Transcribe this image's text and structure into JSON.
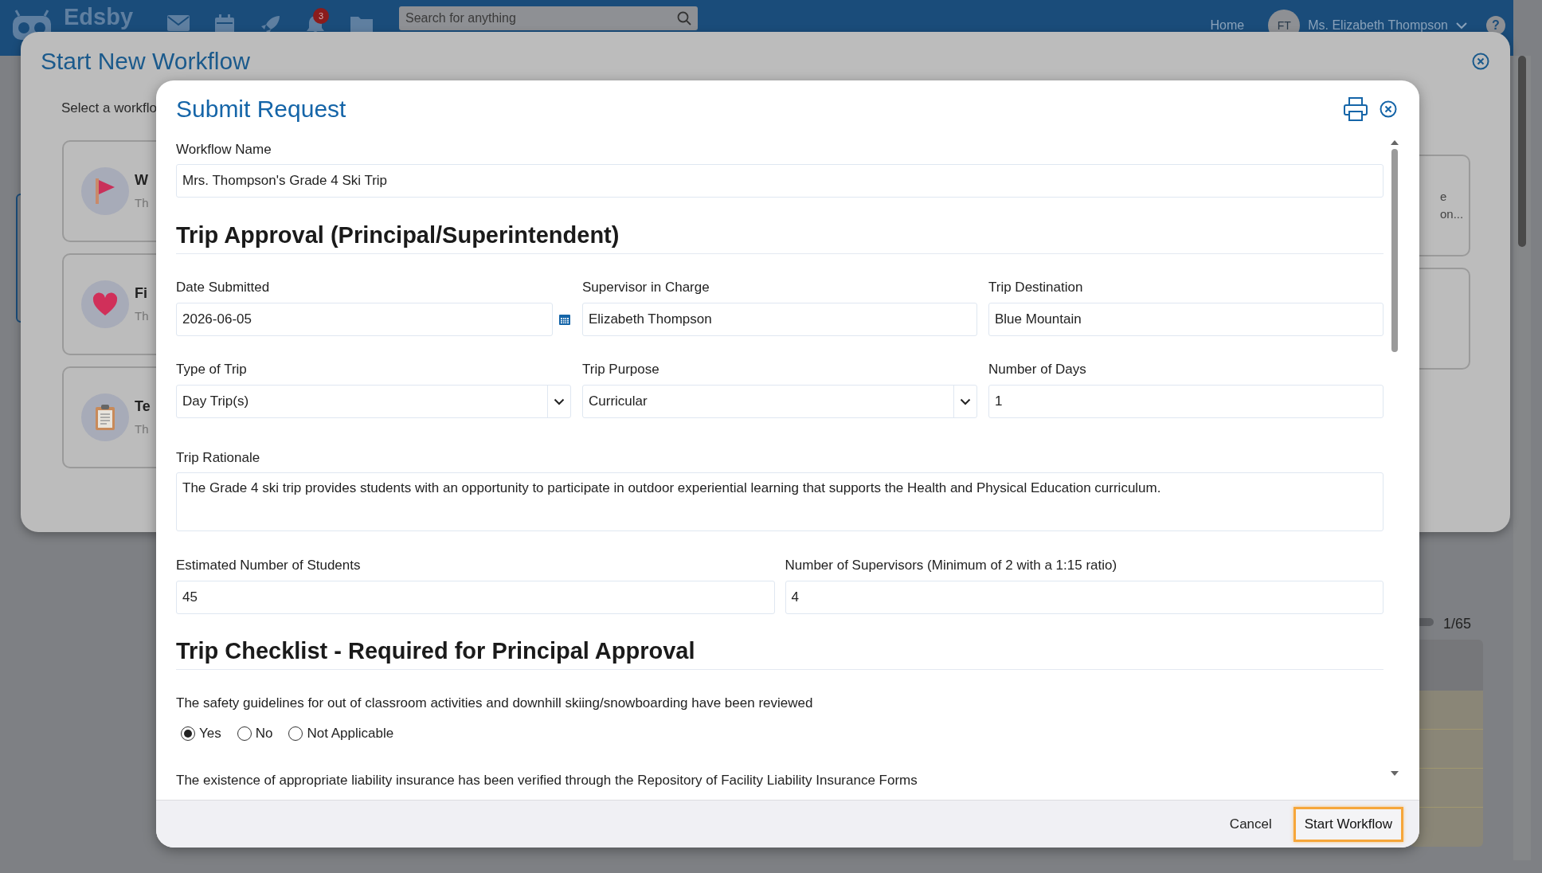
{
  "app_bar": {
    "logo": "Edsby",
    "notification_count": "3",
    "search": {
      "placeholder": "Search for anything"
    },
    "home_link": "Home",
    "user": {
      "initials": "FT",
      "name": "Ms. Elizabeth Thompson"
    },
    "help": "?"
  },
  "workflow_dialog": {
    "title": "Start New Workflow",
    "instruction": "Select a workflo",
    "cards": [
      {
        "kind": "flag",
        "title": "W",
        "description": "Th"
      },
      {
        "kind": "heart",
        "title": "Fi",
        "description": "Th"
      },
      {
        "kind": "clipboard",
        "title": "Te",
        "description": "Th"
      }
    ],
    "right_card_lines": [
      "e",
      "on..."
    ]
  },
  "background_page": {
    "pager": "1/65"
  },
  "request_dialog": {
    "title": "Submit Request",
    "workflow_name": {
      "label": "Workflow Name",
      "value": "Mrs. Thompson's Grade 4 Ski Trip"
    },
    "approval_section": {
      "heading": "Trip Approval (Principal/Superintendent)",
      "field_rows": [
        {
          "fields": [
            {
              "kind": "date",
              "label": "Date Submitted",
              "value": "2026-06-05"
            },
            {
              "kind": "text",
              "label": "Supervisor in Charge",
              "value": "Elizabeth Thompson"
            },
            {
              "kind": "text",
              "label": "Trip Destination",
              "value": "Blue Mountain"
            }
          ]
        },
        {
          "fields": [
            {
              "kind": "select",
              "label": "Type of Trip",
              "value": "Day Trip(s)"
            },
            {
              "kind": "select",
              "label": "Trip Purpose",
              "value": "Curricular"
            },
            {
              "kind": "text",
              "label": "Number of Days",
              "value": "1"
            }
          ]
        },
        {
          "fields": [
            {
              "kind": "textarea",
              "label": "Trip Rationale",
              "value": "The Grade 4 ski trip provides students with an opportunity to participate in outdoor experiential learning that supports the Health and Physical Education curriculum."
            }
          ]
        },
        {
          "fields": [
            {
              "kind": "text",
              "label": "Estimated Number of Students",
              "value": "45"
            },
            {
              "kind": "text",
              "label": "Number of Supervisors (Minimum of 2 with a 1:15 ratio)",
              "value": "4"
            }
          ]
        }
      ]
    },
    "checklist_section": {
      "heading": "Trip Checklist - Required for Principal Approval",
      "questions": [
        {
          "text": "The safety guidelines for out of classroom activities and downhill skiing/snowboarding have been reviewed",
          "options": [
            {
              "label": "Yes",
              "selected": true
            },
            {
              "label": "No",
              "selected": false
            },
            {
              "label": "Not Applicable",
              "selected": false
            }
          ]
        },
        {
          "text": "The existence of appropriate liability insurance has been verified through the Repository of Facility Liability Insurance Forms"
        }
      ]
    },
    "buttons": [
      {
        "label": "Cancel",
        "kind": "secondary",
        "focused": false
      },
      {
        "label": "Start Workflow",
        "kind": "primary",
        "focused": true
      }
    ]
  }
}
